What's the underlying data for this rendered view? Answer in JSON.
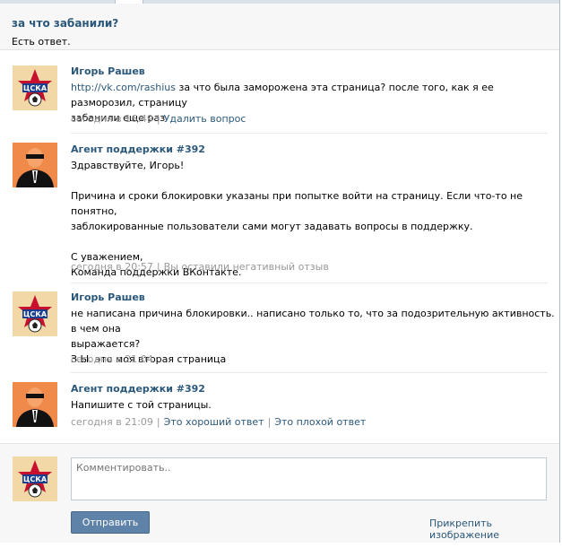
{
  "question": {
    "title": "за что забанили?",
    "status": "Есть ответ."
  },
  "messages": [
    {
      "author": "Игорь Рашев",
      "avatar": "cska-logo",
      "link": "http://vk.com/rashius",
      "text_lines": [
        " за что была заморожена эта страница? после того, как я ее разморозил, страницу",
        "забанили еще раз"
      ],
      "time": "сегодня в 16:49",
      "actions": [
        "Удалить вопрос"
      ]
    },
    {
      "author": "Агент поддержки #392",
      "avatar": "agent-silhouette",
      "text_lines": [
        "Здравствуйте, Игорь!",
        "",
        "Причина и сроки блокировки указаны при попытке войти на страницу. Если что-то не понятно,",
        "заблокированные пользователи сами могут задавать вопросы в поддержку.",
        "",
        "С уважением,",
        "Команда поддержки ВКонтакте."
      ],
      "time": "сегодня в 20:57",
      "note": "Вы оставили негативный отзыв"
    },
    {
      "author": "Игорь Рашев",
      "avatar": "cska-logo",
      "text_lines": [
        "не написана причина блокировки.. написано только то, что за подозрительную активность. в чем она",
        "выражается?",
        "З.Ы. это моя вторая страница"
      ],
      "time": "сегодня в 21:04"
    },
    {
      "author": "Агент поддержки #392",
      "avatar": "agent-silhouette",
      "text_lines": [
        "Напишите с той страницы."
      ],
      "time": "сегодня в 21:09",
      "actions": [
        "Это хороший ответ",
        "Это плохой ответ"
      ]
    }
  ],
  "composer": {
    "placeholder": "Комментировать..",
    "send_label": "Отправить",
    "attach_label": "Прикрепить изображение"
  },
  "colors": {
    "link": "#2b587a",
    "button": "#5e82a8",
    "meta": "#999999"
  }
}
